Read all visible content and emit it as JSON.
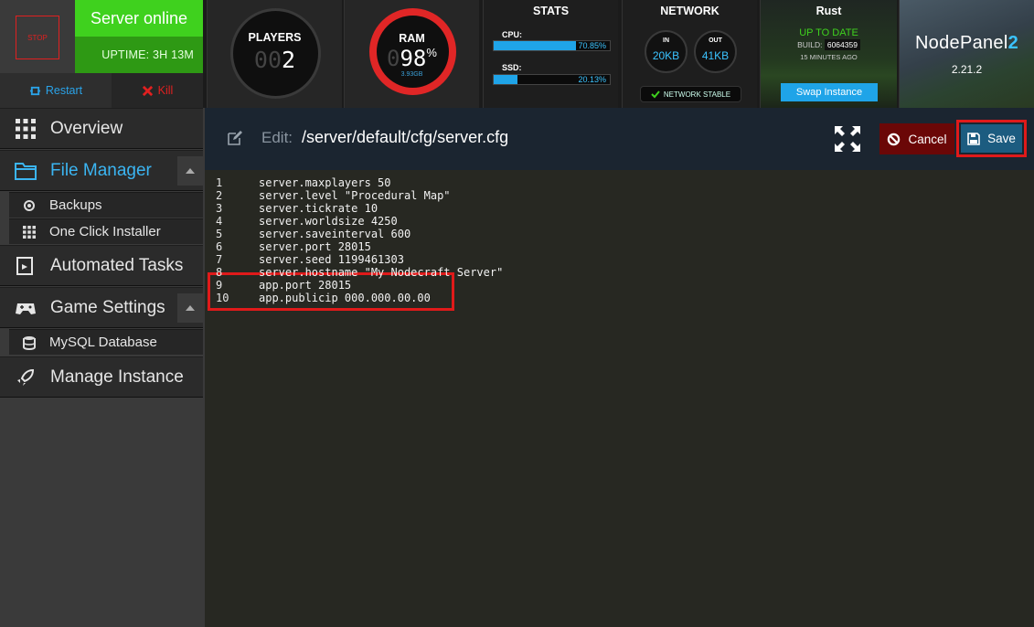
{
  "server": {
    "stop_label": "STOP",
    "status": "Server online",
    "uptime": "UPTIME: 3H 13M",
    "restart_label": "Restart",
    "kill_label": "Kill"
  },
  "players": {
    "title": "PLAYERS",
    "count_dim": "00",
    "count": "2"
  },
  "ram": {
    "title": "RAM",
    "pct_dim": "0",
    "pct": "98",
    "pct_unit": "%",
    "sub": "3.93GB",
    "fraction": 0.98
  },
  "stats": {
    "title": "STATS",
    "cpu_label": "CPU:",
    "cpu_value": "70.85%",
    "cpu_fraction": 0.7085,
    "ssd_label": "SSD:",
    "ssd_value": "20.13%",
    "ssd_fraction": 0.2013
  },
  "network": {
    "title": "NETWORK",
    "in_label": "IN",
    "in_value": "20KB",
    "out_label": "OUT",
    "out_value": "41KB",
    "stable_label": "NETWORK STABLE"
  },
  "game": {
    "title": "Rust",
    "status": "UP TO DATE",
    "build_label": "BUILD:",
    "build_value": "6064359",
    "ago": "15 MINUTES AGO",
    "swap_label": "Swap Instance"
  },
  "brand": {
    "name": "NodePanel",
    "name_num": "2",
    "version": "2.21.2"
  },
  "nav": {
    "overview": "Overview",
    "file_manager": "File Manager",
    "backups": "Backups",
    "one_click": "One Click Installer",
    "automated_tasks": "Automated Tasks",
    "game_settings": "Game Settings",
    "mysql": "MySQL Database",
    "manage_instance": "Manage Instance"
  },
  "editor": {
    "label": "Edit:",
    "path": "/server/default/cfg/server.cfg",
    "cancel_label": "Cancel",
    "save_label": "Save",
    "lines": [
      "server.maxplayers 50",
      "server.level \"Procedural Map\"",
      "server.tickrate 10",
      "server.worldsize 4250",
      "server.saveinterval 600",
      "server.port 28015",
      "server.seed 1199461303",
      "server.hostname \"My Nodecraft Server\"",
      "app.port 28015",
      "app.publicip 000.000.00.00"
    ]
  },
  "colors": {
    "accent": "#1fa4e8",
    "online": "#3fd11e",
    "danger": "#e02020"
  }
}
